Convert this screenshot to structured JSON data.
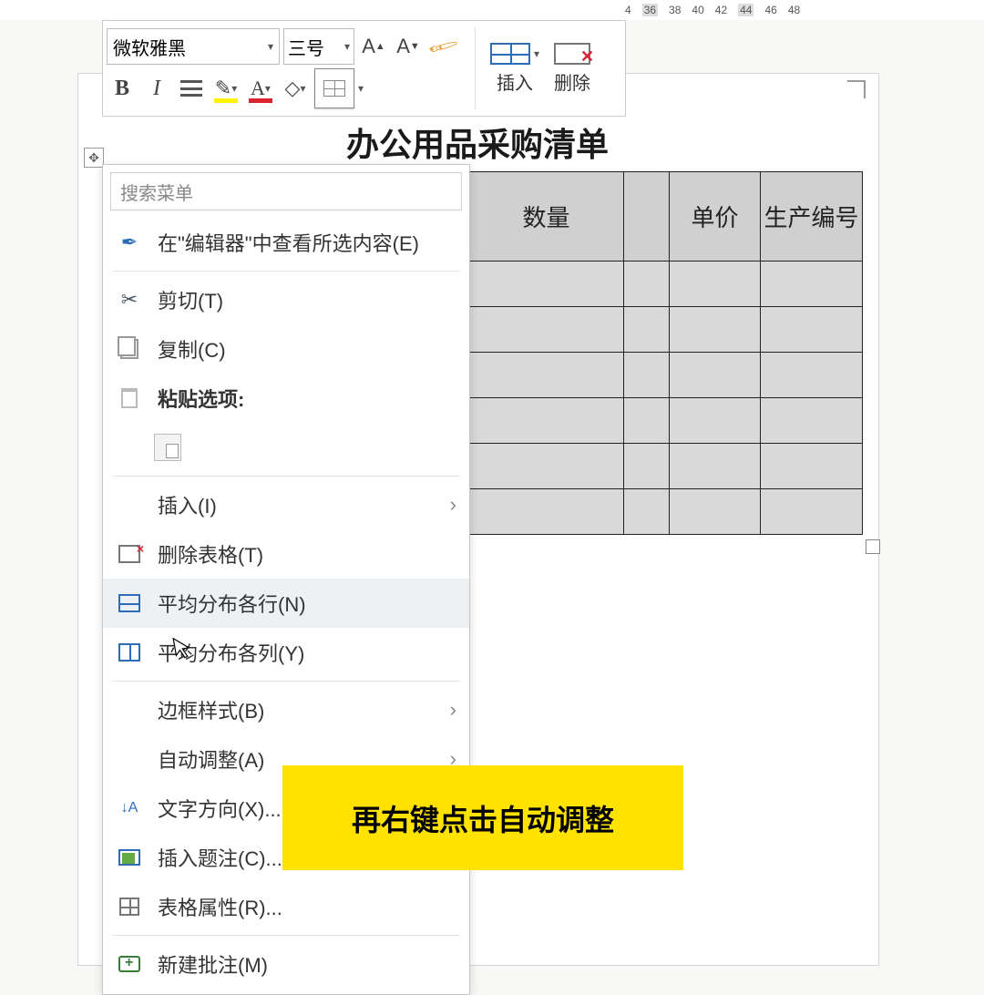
{
  "ruler": {
    "ticks": [
      "4",
      "36",
      "38",
      "40",
      "42",
      "44",
      "46",
      "48"
    ]
  },
  "toolbar": {
    "font_name": "微软雅黑",
    "font_size": "三号",
    "insert_label": "插入",
    "delete_label": "删除"
  },
  "document": {
    "title": "办公用品采购清单",
    "columns": {
      "qty": "数量",
      "price": "单价",
      "prod_no": "生产编号"
    }
  },
  "context_menu": {
    "search_placeholder": "搜索菜单",
    "view_in_editor": "在\"编辑器\"中查看所选内容(E)",
    "cut": "剪切(T)",
    "copy": "复制(C)",
    "paste_options": "粘贴选项:",
    "insert": "插入(I)",
    "delete_table": "删除表格(T)",
    "dist_rows": "平均分布各行(N)",
    "dist_cols": "平均分布各列(Y)",
    "border_style": "边框样式(B)",
    "autofit": "自动调整(A)",
    "text_dir": "文字方向(X)...",
    "caption": "插入题注(C)...",
    "table_props": "表格属性(R)...",
    "new_comment": "新建批注(M)"
  },
  "annotation": "再右键点击自动调整"
}
